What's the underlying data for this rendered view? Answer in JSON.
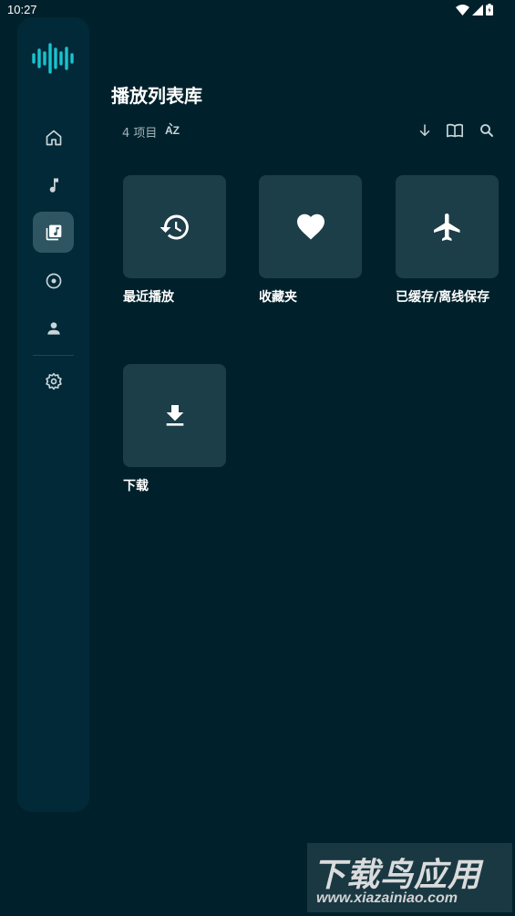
{
  "status_bar": {
    "time": "10:27"
  },
  "library": {
    "title": "播放列表库",
    "count_text": "4 项目",
    "sort_label": "AZ"
  },
  "tiles": [
    {
      "label": "最近播放",
      "icon": "history-icon"
    },
    {
      "label": "收藏夹",
      "icon": "heart-icon"
    },
    {
      "label": "已缓存/离线保存",
      "icon": "airplane-icon"
    },
    {
      "label": "下载",
      "icon": "download-icon"
    }
  ],
  "nav": [
    "home",
    "music-note",
    "library",
    "album",
    "person",
    "settings"
  ],
  "watermark": {
    "title": "下载鸟应用",
    "url": "www.xiazainiao.com"
  },
  "colors": {
    "background": "#00212b",
    "rail": "#022937",
    "tile": "#1c3e48",
    "accent": "#19c3cf"
  }
}
